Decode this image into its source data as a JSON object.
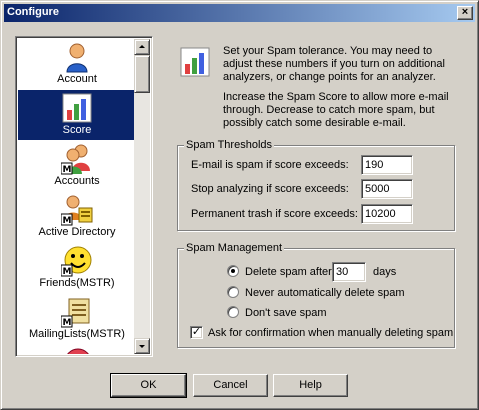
{
  "window": {
    "title": "Configure"
  },
  "sidebar": {
    "items": [
      {
        "label": "Account",
        "icon": "person-icon"
      },
      {
        "label": "Score",
        "icon": "bar-chart-icon",
        "selected": true
      },
      {
        "label": "Accounts",
        "icon": "accounts-icon"
      },
      {
        "label": "Active Directory",
        "icon": "active-directory-icon"
      },
      {
        "label": "Friends(MSTR)",
        "icon": "smiley-icon"
      },
      {
        "label": "MailingLists(MSTR)",
        "icon": "mailing-list-icon"
      }
    ]
  },
  "description": {
    "para1": "Set your Spam tolerance.  You may need to adjust these numbers if you turn on additional analyzers, or change points for an analyzer.",
    "para2": "Increase the Spam Score to allow more e-mail through.  Decrease to catch more spam, but possibly catch some desirable e-mail."
  },
  "thresholds": {
    "title": "Spam Thresholds",
    "spam_label": "E-mail is spam if score exceeds:",
    "spam_value": "190",
    "stop_label": "Stop analyzing if score exceeds:",
    "stop_value": "5000",
    "trash_label": "Permanent trash if score exceeds:",
    "trash_value": "10200"
  },
  "management": {
    "title": "Spam Management",
    "delete_after_label": "Delete spam after",
    "delete_days_value": "30",
    "days_label": "days",
    "never_delete_label": "Never automatically delete spam",
    "dont_save_label": "Don't save spam",
    "confirm_label": "Ask for confirmation when manually deleting spam",
    "selected_option": "delete_after",
    "confirm_checked": true
  },
  "buttons": {
    "ok": "OK",
    "cancel": "Cancel",
    "help": "Help"
  },
  "colors": {
    "selection": "#0a246a",
    "title_bar_start": "#0a246a",
    "title_bar_end": "#a6caf0",
    "face": "#d4d0c8"
  }
}
